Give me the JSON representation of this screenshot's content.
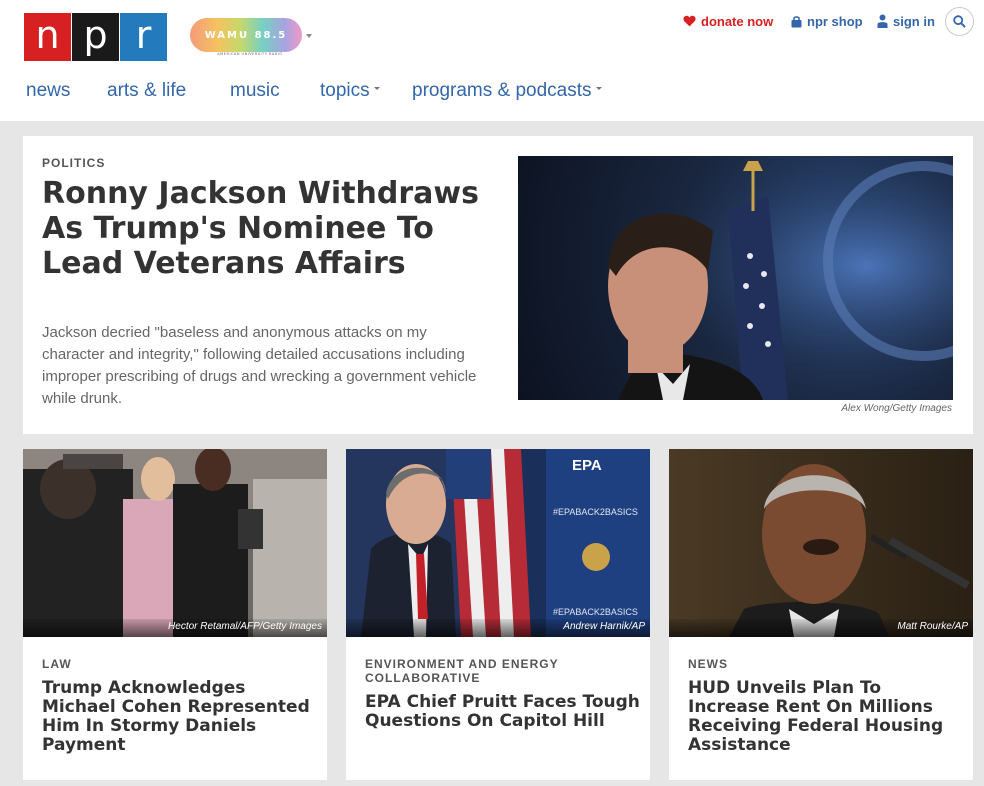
{
  "header": {
    "logo_letters": [
      "n",
      "p",
      "r"
    ],
    "station": {
      "name": "WAMU 88.5",
      "subtitle": "AMERICAN UNIVERSITY RADIO"
    },
    "utility": {
      "donate": "donate now",
      "shop": "npr shop",
      "signin": "sign in"
    },
    "nav": [
      "news",
      "arts & life",
      "music",
      "topics",
      "programs & podcasts"
    ],
    "colors": {
      "npr_red": "#d62021",
      "npr_black": "#1a1a1a",
      "npr_blue": "#237bbd",
      "link_blue": "#3366aa"
    }
  },
  "featured": {
    "slug": "POLITICS",
    "title": "Ronny Jackson Withdraws As Trump's Nominee To Lead Veterans Affairs",
    "teaser": "Jackson decried \"baseless and anonymous attacks on my character and integrity,\" following detailed accusations including improper prescribing of drugs and wrecking a government vehicle while drunk.",
    "credit": "Alex Wong/Getty Images"
  },
  "cards": [
    {
      "slug": "LAW",
      "title": "Trump Acknowledges Michael Cohen Represented Him In Stormy Daniels Payment",
      "credit": "Hector Retamal/AFP/Getty Images"
    },
    {
      "slug": "ENVIRONMENT AND ENERGY COLLABORATIVE",
      "title": "EPA Chief Pruitt Faces Tough Questions On Capitol Hill",
      "credit": "Andrew Harnik/AP",
      "image_text": [
        "EPA",
        "#EPABACK2BASICS",
        "#EPABACK2BASICS"
      ]
    },
    {
      "slug": "NEWS",
      "title": "HUD Unveils Plan To Increase Rent On Millions Receiving Federal Housing Assistance",
      "credit": "Matt Rourke/AP"
    }
  ]
}
